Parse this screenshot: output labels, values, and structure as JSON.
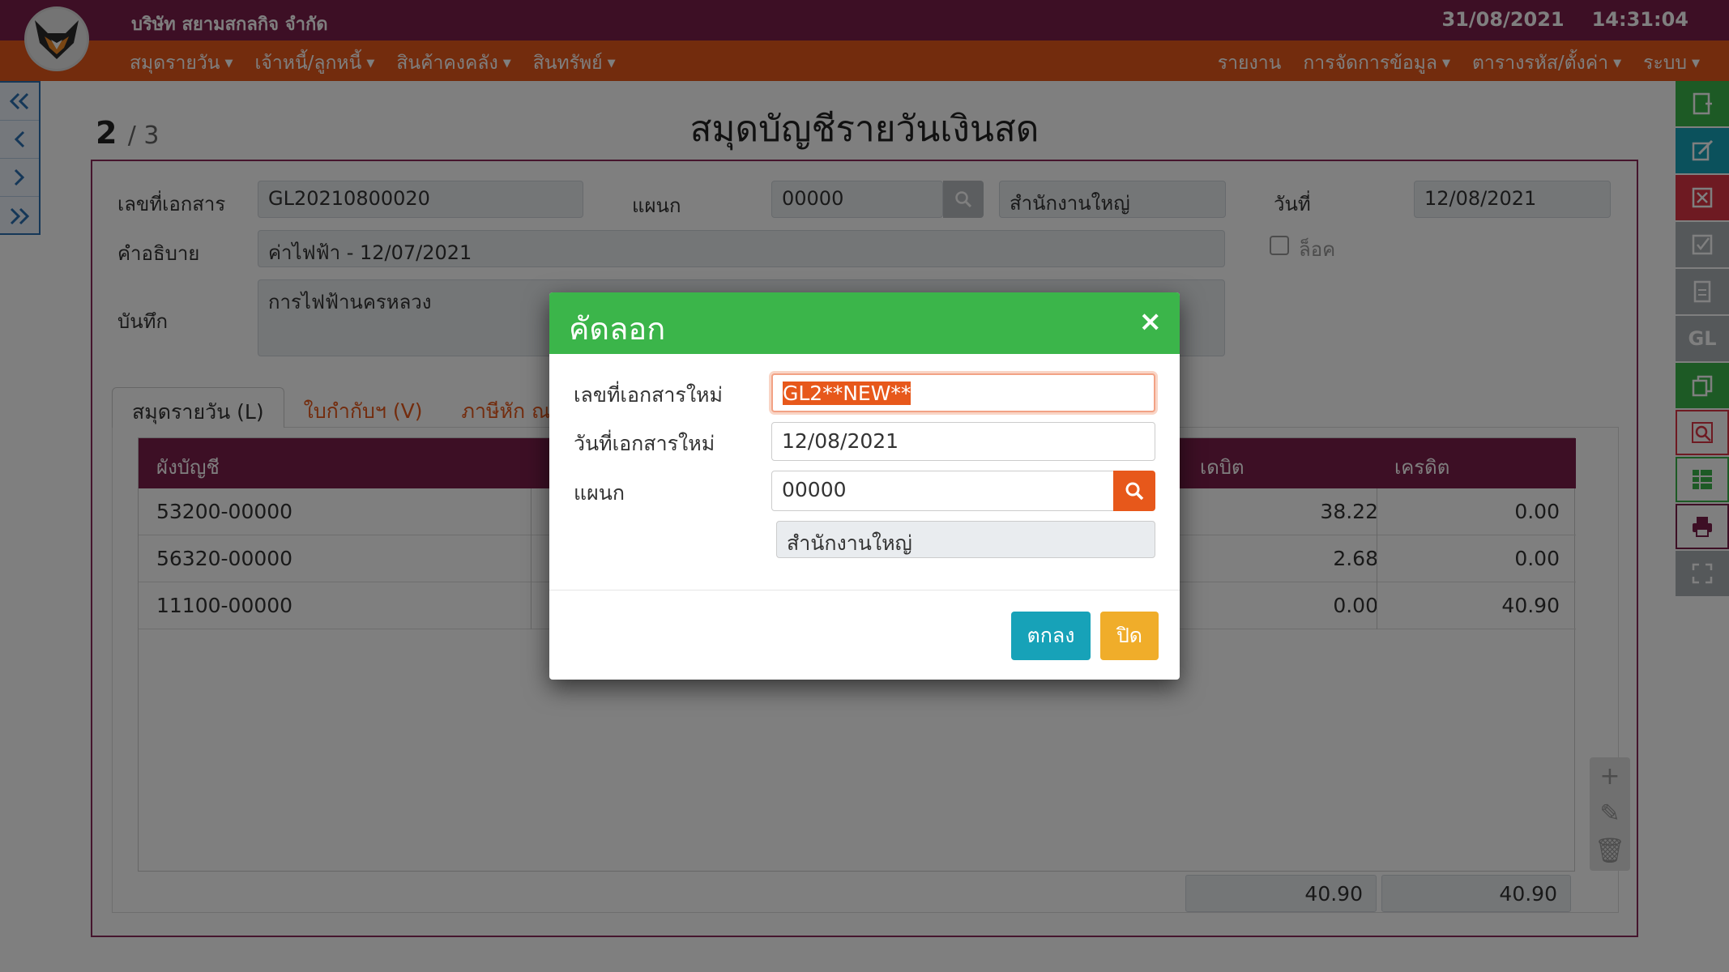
{
  "header": {
    "company": "บริษัท สยามสกลกิจ จำกัด",
    "date": "31/08/2021",
    "time": "14:31:04"
  },
  "menu_left": [
    "สมุดรายวัน",
    "เจ้าหนี้/ลูกหนี้",
    "สินค้าคงคลัง",
    "สินทรัพย์"
  ],
  "menu_right": [
    "รายงาน",
    "การจัดการข้อมูล",
    "ตารางรหัส/ตั้งค่า",
    "ระบบ"
  ],
  "pager": {
    "current": "2",
    "total": "/ 3"
  },
  "page_title": "สมุดบัญชีรายวันเงินสด",
  "form": {
    "doc_no_label": "เลขที่เอกสาร",
    "doc_no": "GL20210800020",
    "dept_label": "แผนก",
    "dept_code": "00000",
    "dept_name": "สำนักงานใหญ่",
    "date_label": "วันที่",
    "date": "12/08/2021",
    "desc_label": "คำอธิบาย",
    "desc": "ค่าไฟฟ้า - 12/07/2021",
    "lock_label": "ล็อค",
    "note_label": "บันทึก",
    "note": "การไฟฟ้านครหลวง"
  },
  "tabs": [
    "สมุดรายวัน (L)",
    "ใบกำกับฯ (V)",
    "ภาษีหัก ณ ที"
  ],
  "grid": {
    "headers": {
      "account": "ผังบัญชี",
      "debit": "เดบิต",
      "credit": "เครดิต"
    },
    "rows": [
      {
        "account": "53200-00000",
        "debit": "38.22",
        "credit": "0.00"
      },
      {
        "account": "56320-00000",
        "debit": "2.68",
        "credit": "0.00"
      },
      {
        "account": "11100-00000",
        "debit": "0.00",
        "credit": "40.90"
      }
    ],
    "total_debit": "40.90",
    "total_credit": "40.90"
  },
  "modal": {
    "title": "คัดลอก",
    "close": "×",
    "new_doc_label": "เลขที่เอกสารใหม่",
    "new_doc_value": "GL2**NEW**",
    "new_date_label": "วันที่เอกสารใหม่",
    "new_date_value": "12/08/2021",
    "dept_label": "แผนก",
    "dept_value": "00000",
    "dept_name": "สำนักงานใหญ่",
    "ok_label": "ตกลง",
    "close_label": "ปิด"
  },
  "colors": {
    "topbar": "#7a1e4a",
    "navbar": "#e7581b",
    "modal_header": "#3bb54a",
    "ok_button": "#17a2b8",
    "close_button": "#f0ad2a"
  },
  "right_toolbar_icons": [
    "new-document-icon",
    "edit-icon",
    "delete-icon",
    "approve-icon",
    "post-icon",
    "gl-icon",
    "copy-icon",
    "preview-icon",
    "spreadsheet-icon",
    "print-icon",
    "fullscreen-icon"
  ],
  "right_toolbar_text": {
    "gl": "GL"
  },
  "grid_tool_icons": [
    "add-row-icon",
    "edit-row-icon",
    "delete-row-icon"
  ]
}
